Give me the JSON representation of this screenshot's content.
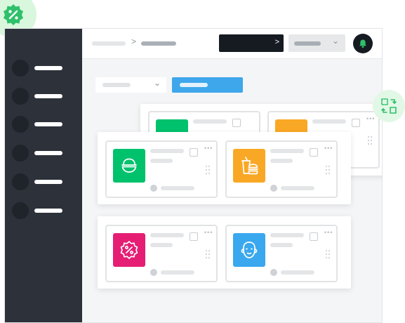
{
  "colors": {
    "sidebar_bg": "#2c313a",
    "accent_blue": "#3ea7ec",
    "dark_button": "#161b22",
    "notification": "#2ec06a",
    "tile_green": "#00c16c",
    "tile_orange": "#f9a825",
    "tile_pink": "#e51e74",
    "tile_blue": "#3aa8ee"
  },
  "sidebar": {
    "items": [
      {
        "icon": "nav-placeholder-icon"
      },
      {
        "icon": "nav-placeholder-icon"
      },
      {
        "icon": "nav-placeholder-icon"
      },
      {
        "icon": "nav-placeholder-icon"
      },
      {
        "icon": "nav-placeholder-icon"
      },
      {
        "icon": "nav-placeholder-icon"
      }
    ]
  },
  "header": {
    "breadcrumb_separator": ">",
    "action_arrow": ">",
    "dropdown_chevron": "⌄",
    "notification_icon": "bell-icon"
  },
  "toolbar": {
    "filter_chevron": "⌄"
  },
  "cards": [
    {
      "icon": "rice-bowl-icon",
      "tile_color": "#00c16c",
      "more": "•••"
    },
    {
      "icon": "fast-food-icon",
      "tile_color": "#f9a825",
      "more": "•••"
    },
    {
      "icon": "discount-badge-icon",
      "tile_color": "#e51e74",
      "more": "•••"
    },
    {
      "icon": "baby-face-icon",
      "tile_color": "#3aa8ee",
      "more": "•••"
    }
  ],
  "floating_badges": {
    "promo": "discount-badge-icon",
    "swap": "swap-icon"
  }
}
